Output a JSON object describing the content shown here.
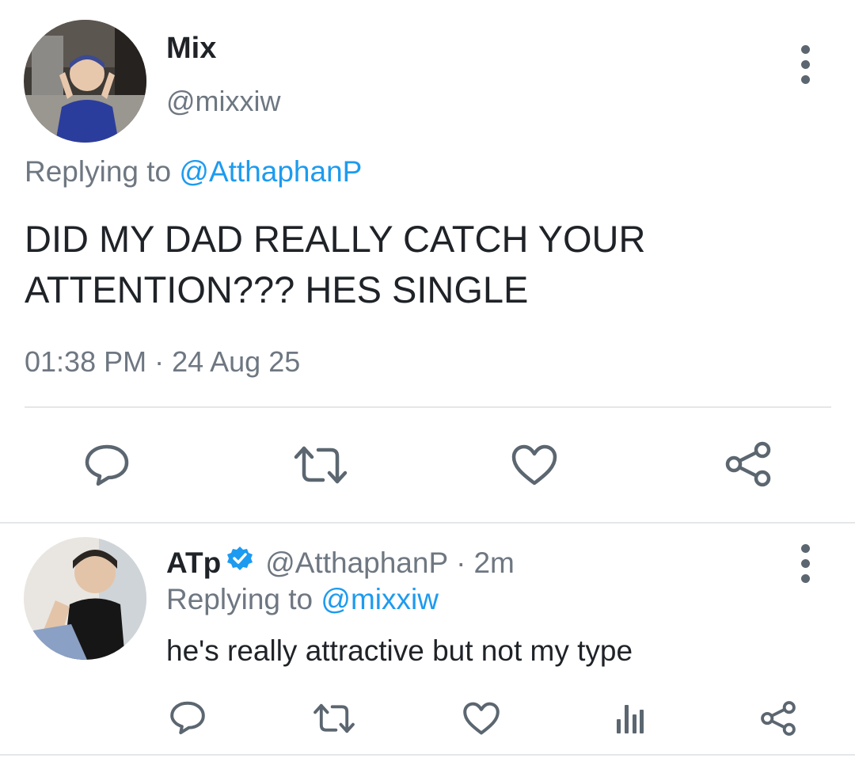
{
  "main_tweet": {
    "display_name": "Mix",
    "handle": "@mixxiw",
    "replying_prefix": "Replying to",
    "replying_handle": "@AtthaphanP",
    "text_line1": "DID MY DAD REALLY CATCH YOUR",
    "text_line2": "ATTENTION??? HES SINGLE",
    "timestamp": "01:38 PM · 24 Aug 25",
    "actions": [
      "reply-icon",
      "retweet-icon",
      "like-icon",
      "share-icon"
    ]
  },
  "reply_tweet": {
    "display_name": "ATp",
    "verified": true,
    "handle": "@AtthaphanP",
    "separator": "·",
    "age": "2m",
    "replying_prefix": "Replying to",
    "replying_handle": "@mixxiw",
    "text": "he's really attractive but not my type",
    "actions": [
      "reply-icon",
      "retweet-icon",
      "like-icon",
      "analytics-icon",
      "share-icon"
    ]
  },
  "colors": {
    "link": "#1d9bf0",
    "muted": "#6e7781",
    "icon": "#5b6670",
    "divider": "#e4e7ea"
  }
}
